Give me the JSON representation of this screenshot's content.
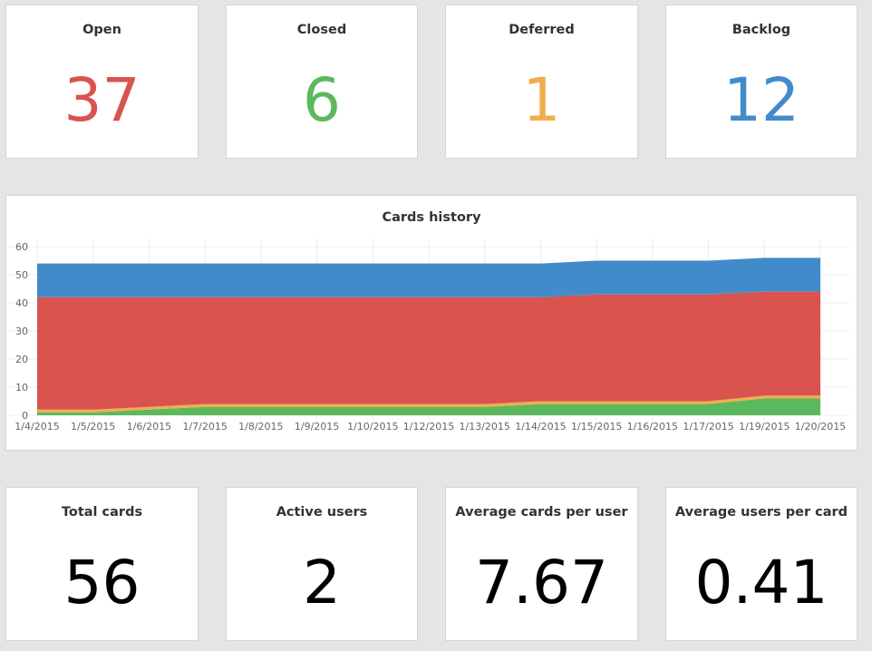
{
  "top_stats": [
    {
      "label": "Open",
      "value": "37",
      "color": "#d9534f"
    },
    {
      "label": "Closed",
      "value": "6",
      "color": "#5cb85c"
    },
    {
      "label": "Deferred",
      "value": "1",
      "color": "#f0ad4e"
    },
    {
      "label": "Backlog",
      "value": "12",
      "color": "#428bca"
    }
  ],
  "chart_panel": {
    "title": "Cards history"
  },
  "bottom_stats": [
    {
      "label": "Total cards",
      "value": "56"
    },
    {
      "label": "Active users",
      "value": "2"
    },
    {
      "label": "Average cards per user",
      "value": "7.67"
    },
    {
      "label": "Average users per card",
      "value": "0.41"
    }
  ],
  "chart_data": {
    "type": "area",
    "title": "Cards history",
    "xlabel": "",
    "ylabel": "",
    "stacked": true,
    "ylim": [
      0,
      60
    ],
    "yticks": [
      0,
      10,
      20,
      30,
      40,
      50,
      60
    ],
    "grid": true,
    "categories": [
      "1/4/2015",
      "1/5/2015",
      "1/6/2015",
      "1/7/2015",
      "1/8/2015",
      "1/9/2015",
      "1/10/2015",
      "1/12/2015",
      "1/13/2015",
      "1/14/2015",
      "1/15/2015",
      "1/16/2015",
      "1/17/2015",
      "1/19/2015",
      "1/20/2015"
    ],
    "series": [
      {
        "color": "#5cb85c",
        "values": [
          1,
          1,
          2,
          3,
          3,
          3,
          3,
          3,
          3,
          4,
          4,
          4,
          4,
          6,
          6
        ]
      },
      {
        "color": "#f0ad4e",
        "values": [
          1,
          1,
          1,
          1,
          1,
          1,
          1,
          1,
          1,
          1,
          1,
          1,
          1,
          1,
          1
        ]
      },
      {
        "color": "#d9534f",
        "values": [
          40,
          40,
          39,
          38,
          38,
          38,
          38,
          38,
          38,
          37,
          38,
          38,
          38,
          37,
          37
        ]
      },
      {
        "color": "#428bca",
        "values": [
          12,
          12,
          12,
          12,
          12,
          12,
          12,
          12,
          12,
          12,
          12,
          12,
          12,
          12,
          12
        ]
      }
    ]
  }
}
